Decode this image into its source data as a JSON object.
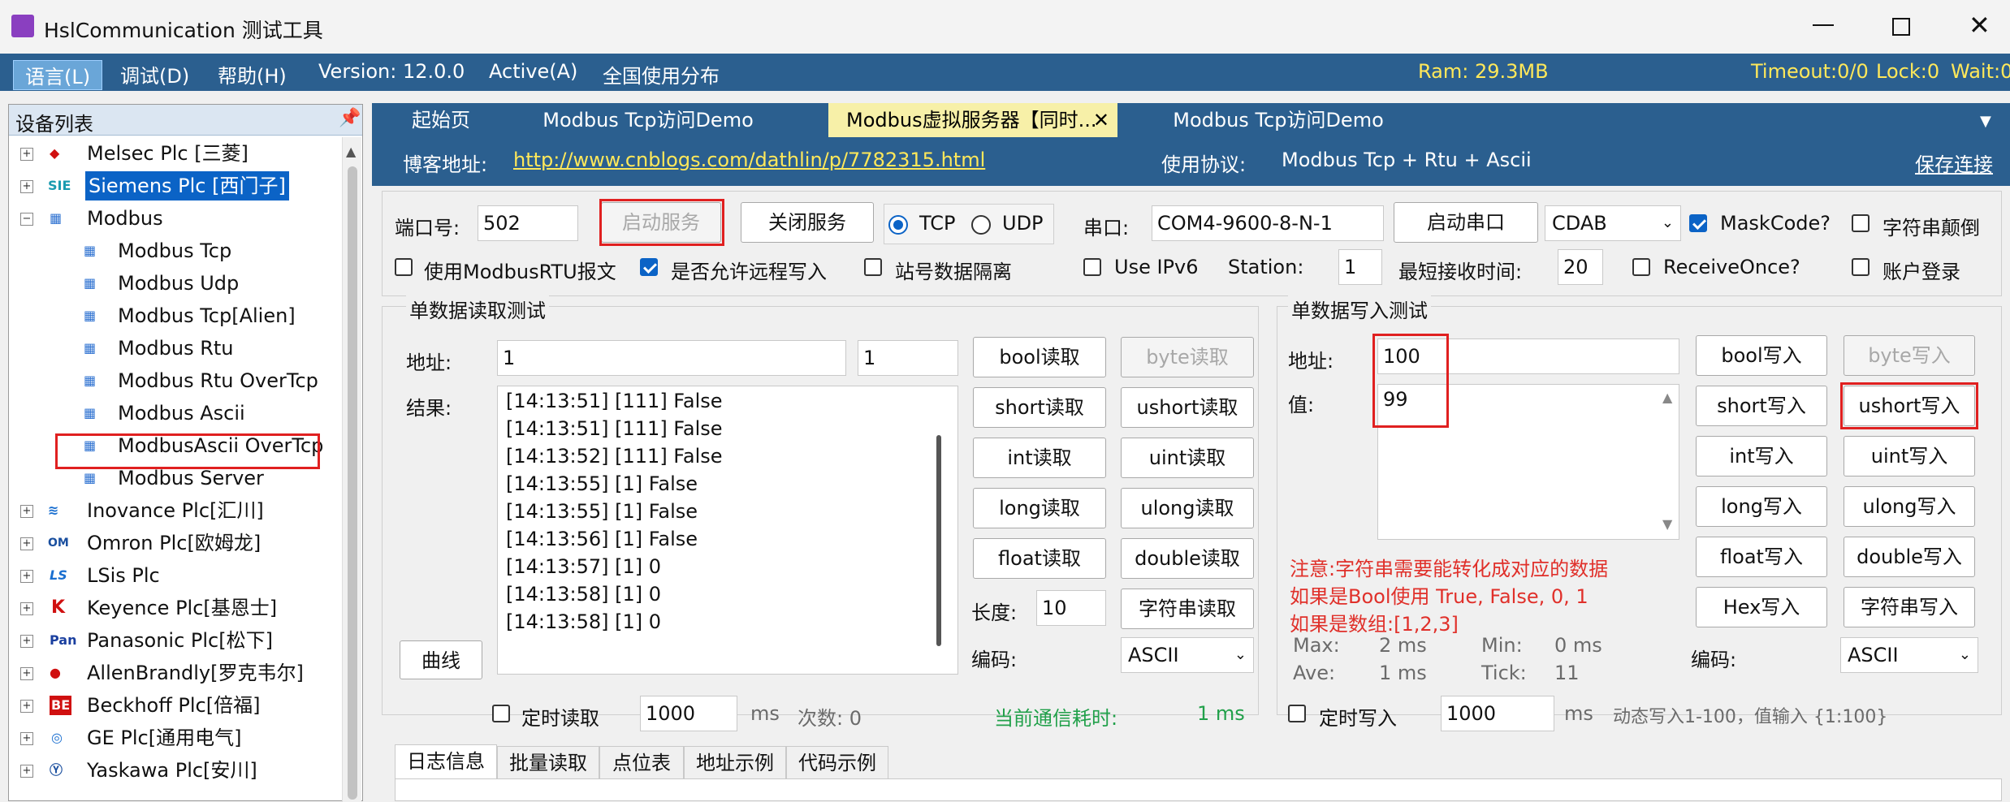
{
  "window": {
    "title": "HslCommunication 测试工具",
    "minimize_icon": "minimize-icon",
    "maximize_icon": "maximize-icon",
    "close_icon": "close-icon"
  },
  "menu": {
    "language": "语言(L)",
    "debug": "调试(D)",
    "help": "帮助(H)",
    "version": "Version: 12.0.0",
    "active": "Active(A)",
    "global": "全国使用分布",
    "ram": "Ram: 29.3MB",
    "timeout": "Timeout:0/0",
    "lock": "Lock:0",
    "wait": "Wait:0"
  },
  "device_list": {
    "title": "设备列表",
    "pin_icon": "pin-icon",
    "items": [
      {
        "label": "Melsec Plc [三菱]",
        "icon": "mitsubishi-icon"
      },
      {
        "label": "Siemens Plc [西门子]",
        "icon": "siemens-icon"
      },
      {
        "label": "Modbus",
        "icon": "network-icon"
      },
      {
        "label": "Modbus Tcp",
        "icon": "network-icon"
      },
      {
        "label": "Modbus Udp",
        "icon": "network-icon"
      },
      {
        "label": "Modbus Tcp[Alien]",
        "icon": "network-icon"
      },
      {
        "label": "Modbus Rtu",
        "icon": "network-icon"
      },
      {
        "label": "Modbus Rtu OverTcp",
        "icon": "network-icon"
      },
      {
        "label": "Modbus Ascii",
        "icon": "network-icon"
      },
      {
        "label": "ModbusAscii OverTcp",
        "icon": "network-icon"
      },
      {
        "label": "Modbus Server",
        "icon": "network-icon"
      },
      {
        "label": "Inovance Plc[汇川]",
        "icon": "inovance-icon"
      },
      {
        "label": "Omron Plc[欧姆龙]",
        "icon": "omron-icon"
      },
      {
        "label": "LSis Plc",
        "icon": "ls-icon"
      },
      {
        "label": "Keyence Plc[基恩士]",
        "icon": "keyence-icon"
      },
      {
        "label": "Panasonic Plc[松下]",
        "icon": "panasonic-icon"
      },
      {
        "label": "AllenBrandly[罗克韦尔]",
        "icon": "allen-bradley-icon"
      },
      {
        "label": "Beckhoff Plc[倍福]",
        "icon": "beckhoff-icon"
      },
      {
        "label": "GE Plc[通用电气]",
        "icon": "ge-icon"
      },
      {
        "label": "Yaskawa Plc[安川]",
        "icon": "yaskawa-icon"
      }
    ]
  },
  "tabs": [
    {
      "label": "起始页"
    },
    {
      "label": "Modbus Tcp访问Demo"
    },
    {
      "label": "Modbus虚拟服务器【同时..."
    },
    {
      "label": "Modbus Tcp访问Demo"
    }
  ],
  "info": {
    "blog_label": "博客地址:",
    "blog_url": "http://www.cnblogs.com/dathlin/p/7782315.html",
    "protocol_label": "使用协议:",
    "protocol_value": "Modbus Tcp + Rtu + Ascii",
    "save_link": "保存连接"
  },
  "server": {
    "port_label": "端口号:",
    "port_value": "502",
    "start_button": "启动服务",
    "close_button": "关闭服务",
    "tcp": "TCP",
    "udp": "UDP",
    "serial_label": "串口:",
    "serial_value": "COM4-9600-8-N-1",
    "open_serial": "启动串口",
    "byte_order": "CDAB",
    "maskcode": "MaskCode?",
    "string_reverse": "字符串颠倒",
    "use_rtu": "使用ModbusRTU报文",
    "allow_remote": "是否允许远程写入",
    "station_isolation": "站号数据隔离",
    "use_ipv6": "Use IPv6",
    "station_label": "Station:",
    "station_value": "1",
    "min_recv_label": "最短接收时间:",
    "min_recv_value": "20",
    "receive_once": "ReceiveOnce?",
    "account_login": "账户登录"
  },
  "read_panel": {
    "title": "单数据读取测试",
    "address_label": "地址:",
    "address_value": "1",
    "count_value": "1",
    "result_label": "结果:",
    "curve_button": "曲线",
    "log": [
      "[14:13:51] [111] False",
      "[14:13:51] [111] False",
      "[14:13:52] [111] False",
      "[14:13:55] [1] False",
      "[14:13:55] [1] False",
      "[14:13:56] [1] False",
      "[14:13:57] [1] 0",
      "[14:13:58] [1] 0",
      "[14:13:58] [1] 0"
    ],
    "buttons": [
      "bool读取",
      "byte读取",
      "short读取",
      "ushort读取",
      "int读取",
      "uint读取",
      "long读取",
      "ulong读取",
      "float读取",
      "double读取"
    ],
    "length_label": "长度:",
    "length_value": "10",
    "string_read": "字符串读取",
    "encoding_label": "编码:",
    "encoding_value": "ASCII",
    "timed_read": "定时读取",
    "timed_value": "1000",
    "ms": "ms",
    "count_text": "次数: 0",
    "comm_cost_label": "当前通信耗时:",
    "comm_cost_value": "1 ms"
  },
  "write_panel": {
    "title": "单数据写入测试",
    "address_label": "地址:",
    "address_value": "100",
    "value_label": "值:",
    "value_value": "99",
    "notes": [
      "注意:字符串需要能转化成对应的数据",
      "如果是Bool使用 True, False, 0, 1",
      "如果是数组:[1,2,3]"
    ],
    "max_label": "Max:",
    "max_value": "2 ms",
    "min_label": "Min:",
    "min_value": "0 ms",
    "ave_label": "Ave:",
    "ave_value": "1 ms",
    "tick_label": "Tick:",
    "tick_value": "11",
    "buttons": [
      "bool写入",
      "byte写入",
      "short写入",
      "ushort写入",
      "int写入",
      "uint写入",
      "long写入",
      "ulong写入",
      "float写入",
      "double写入",
      "Hex写入",
      "字符串写入"
    ],
    "encoding_label": "编码:",
    "encoding_value": "ASCII",
    "timed_write": "定时写入",
    "timed_value": "1000",
    "ms": "ms",
    "dynamic_text": "动态写入1-100，值输入 {1:100}"
  },
  "bottom_tabs": [
    "日志信息",
    "批量读取",
    "点位表",
    "地址示例",
    "代码示例"
  ],
  "colors": {
    "menu_bg": "#2b5f8f",
    "accent": "#0b63c6",
    "highlight_red": "#e02020",
    "active_tab": "#f7f0a8",
    "ram_yellow": "#ffe85a"
  }
}
